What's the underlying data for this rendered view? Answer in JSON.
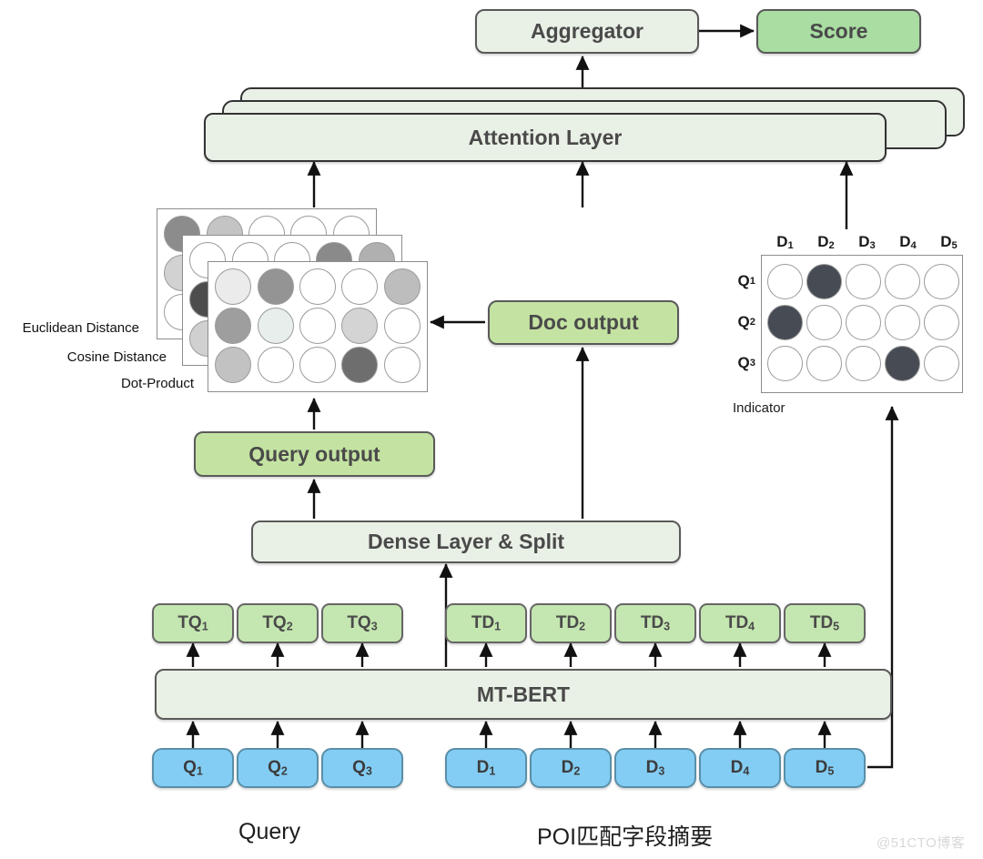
{
  "diagram": {
    "title_bottom_left": "Query",
    "title_bottom_right": "POI匹配字段摘要",
    "watermark": "@51CTO博客"
  },
  "nodes": {
    "aggregator": "Aggregator",
    "score": "Score",
    "attention_layer": "Attention Layer",
    "doc_output": "Doc output",
    "query_output": "Query output",
    "dense_layer": "Dense Layer & Split",
    "mt_bert": "MT-BERT",
    "indicator_label": "Indicator"
  },
  "metrics": [
    "Euclidean Distance",
    "Cosine Distance",
    "Dot-Product"
  ],
  "tokens": {
    "query": [
      "T",
      "T",
      "T"
    ],
    "query_sub": [
      "Q1",
      "Q2",
      "Q3"
    ],
    "doc": [
      "T",
      "T",
      "T",
      "T",
      "T"
    ],
    "doc_sub": [
      "D1",
      "D2",
      "D3",
      "D4",
      "D5"
    ]
  },
  "inputs": {
    "query": [
      "Q1",
      "Q2",
      "Q3"
    ],
    "doc": [
      "D1",
      "D2",
      "D3",
      "D4",
      "D5"
    ]
  },
  "indicator": {
    "col_headers": [
      "D1",
      "D2",
      "D3",
      "D4",
      "D5"
    ],
    "row_headers": [
      "Q1",
      "Q2",
      "Q3"
    ],
    "fill_color": "#474c54",
    "empty_color": "#ffffff",
    "cells": [
      [
        0,
        1,
        0,
        0,
        0
      ],
      [
        1,
        0,
        0,
        0,
        0
      ],
      [
        0,
        0,
        0,
        1,
        0
      ]
    ]
  },
  "similarity_matrices": [
    {
      "name": "Euclidean Distance",
      "grid": [
        [
          "#8c8c8c",
          "#c4c4c4",
          "#ffffff",
          "#ffffff",
          "#ffffff"
        ],
        [
          "#d2d2d2",
          "#ffffff",
          "#ffffff",
          "#bdbdbd",
          "#ffffff"
        ],
        [
          "#ffffff",
          "#ffffff",
          "#a8a8a8",
          "#ffffff",
          "#d6d6d6"
        ]
      ]
    },
    {
      "name": "Cosine Distance",
      "grid": [
        [
          "#ffffff",
          "#ffffff",
          "#ffffff",
          "#8a8a8a",
          "#b0b0b0"
        ],
        [
          "#4d4d4d",
          "#ffffff",
          "#ffffff",
          "#ffffff",
          "#c9c9c9"
        ],
        [
          "#d0d0d0",
          "#ffffff",
          "#bfbfbf",
          "#ffffff",
          "#ffffff"
        ]
      ]
    },
    {
      "name": "Dot-Product",
      "grid": [
        [
          "#ebebeb",
          "#949494",
          "#ffffff",
          "#ffffff",
          "#bdbdbd"
        ],
        [
          "#9e9e9e",
          "#e7eeeb",
          "#ffffff",
          "#d4d4d4",
          "#ffffff"
        ],
        [
          "#c2c2c2",
          "#ffffff",
          "#ffffff",
          "#6e6e6e",
          "#ffffff"
        ]
      ]
    }
  ],
  "colors": {
    "pale_green": "#e9f0e6",
    "green": "#c4e3a2",
    "score_green": "#a9dda2",
    "token_green": "#c4e6b0",
    "blue": "#83cdf4",
    "stroke": "#333333",
    "text": "#4a4a4a"
  }
}
